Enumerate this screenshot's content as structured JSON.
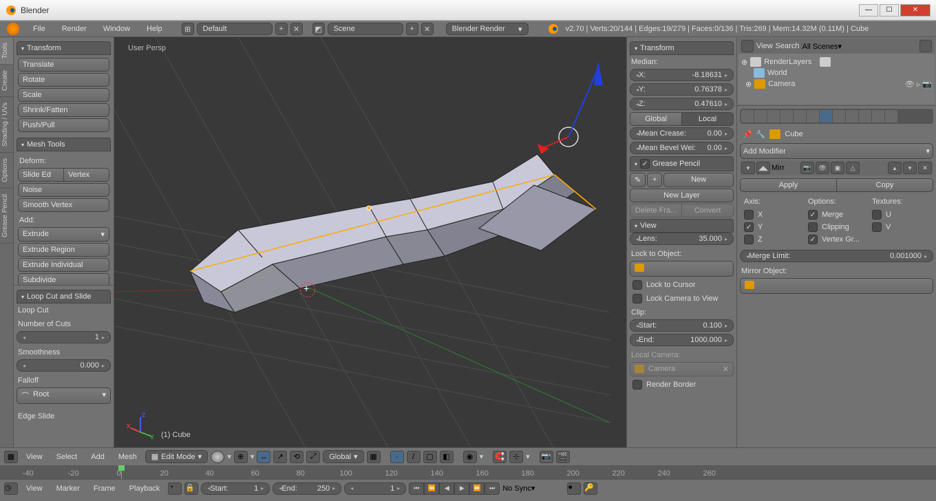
{
  "window": {
    "title": "Blender"
  },
  "topmenu": {
    "file": "File",
    "render": "Render",
    "window": "Window",
    "help": "Help"
  },
  "topbar": {
    "layout": "Default",
    "scene": "Scene",
    "engine": "Blender Render",
    "stats": "v2.70 | Verts:20/144 | Edges:19/279 | Faces:0/136 | Tris:269 | Mem:14.32M (0.11M) | Cube"
  },
  "left_tabs": [
    "Grease Pencil",
    "Options",
    "Shading / UVs",
    "Create",
    "Tools"
  ],
  "toolshelf": {
    "transform_header": "Transform",
    "translate": "Translate",
    "rotate": "Rotate",
    "scale": "Scale",
    "shrink": "Shrink/Fatten",
    "push": "Push/Pull",
    "mesh_header": "Mesh Tools",
    "deform": "Deform:",
    "slide": "Slide Ed",
    "vertex": "Vertex",
    "noise": "Noise",
    "smooth": "Smooth Vertex",
    "add": "Add:",
    "extrude": "Extrude",
    "extrude_region": "Extrude Region",
    "extrude_ind": "Extrude Individual",
    "subdivide": "Subdivide"
  },
  "operator": {
    "header": "Loop Cut and Slide",
    "loopcut": "Loop Cut",
    "num_cuts_label": "Number of Cuts",
    "num_cuts": "1",
    "smoothness_label": "Smoothness",
    "smoothness": "0.000",
    "falloff_label": "Falloff",
    "falloff": "Root",
    "edgeslide": "Edge Slide"
  },
  "viewport": {
    "persp": "User Persp",
    "obj": "(1) Cube"
  },
  "npanel": {
    "transform": "Transform",
    "median": "Median:",
    "x": "X:",
    "xv": "-8.18631",
    "y": "Y:",
    "yv": "0.76378",
    "z": "Z:",
    "zv": "0.47610",
    "global": "Global",
    "local": "Local",
    "crease": "Mean Crease:",
    "crease_v": "0.00",
    "bevel": "Mean Bevel Wei:",
    "bevel_v": "0.00",
    "gp": "Grease Pencil",
    "new": "New",
    "newlayer": "New Layer",
    "delfr": "Delete Fra...",
    "convert": "Convert",
    "view": "View",
    "lens": "Lens:",
    "lens_v": "35.000",
    "lockobj": "Lock to Object:",
    "lockcursor": "Lock to Cursor",
    "lockcam": "Lock Camera to View",
    "clip": "Clip:",
    "start": "Start:",
    "start_v": "0.100",
    "end": "End:",
    "end_v": "1000.000",
    "localcam": "Local Camera:",
    "camera": "Camera",
    "renderborder": "Render Border"
  },
  "outliner": {
    "view": "View",
    "search": "Search",
    "allscenes": "All Scenes",
    "renderlayers": "RenderLayers",
    "world": "World",
    "camera": "Camera"
  },
  "props": {
    "cube": "Cube",
    "addmod": "Add Modifier",
    "mirror": "Mirr",
    "apply": "Apply",
    "copy": "Copy",
    "axis": "Axis:",
    "options": "Options:",
    "textures": "Textures:",
    "X": "X",
    "Y": "Y",
    "Z": "Z",
    "merge": "Merge",
    "clipping": "Clipping",
    "vgroup": "Vertex Gr...",
    "U": "U",
    "V": "V",
    "mergelimit": "Merge Limit:",
    "mergelimit_v": "0.001000",
    "mirrorobj": "Mirror Object:"
  },
  "vpheader": {
    "view": "View",
    "select": "Select",
    "add": "Add",
    "mesh": "Mesh",
    "mode": "Edit Mode",
    "orient": "Global"
  },
  "timeline": {
    "view": "View",
    "marker": "Marker",
    "frame": "Frame",
    "playback": "Playback",
    "start_l": "Start:",
    "start": "1",
    "end_l": "End:",
    "end": "250",
    "cur": "1",
    "sync": "No Sync",
    "ticks": [
      -40,
      -20,
      0,
      20,
      40,
      60,
      80,
      100,
      120,
      140,
      160,
      180,
      200,
      220,
      240,
      260
    ]
  }
}
